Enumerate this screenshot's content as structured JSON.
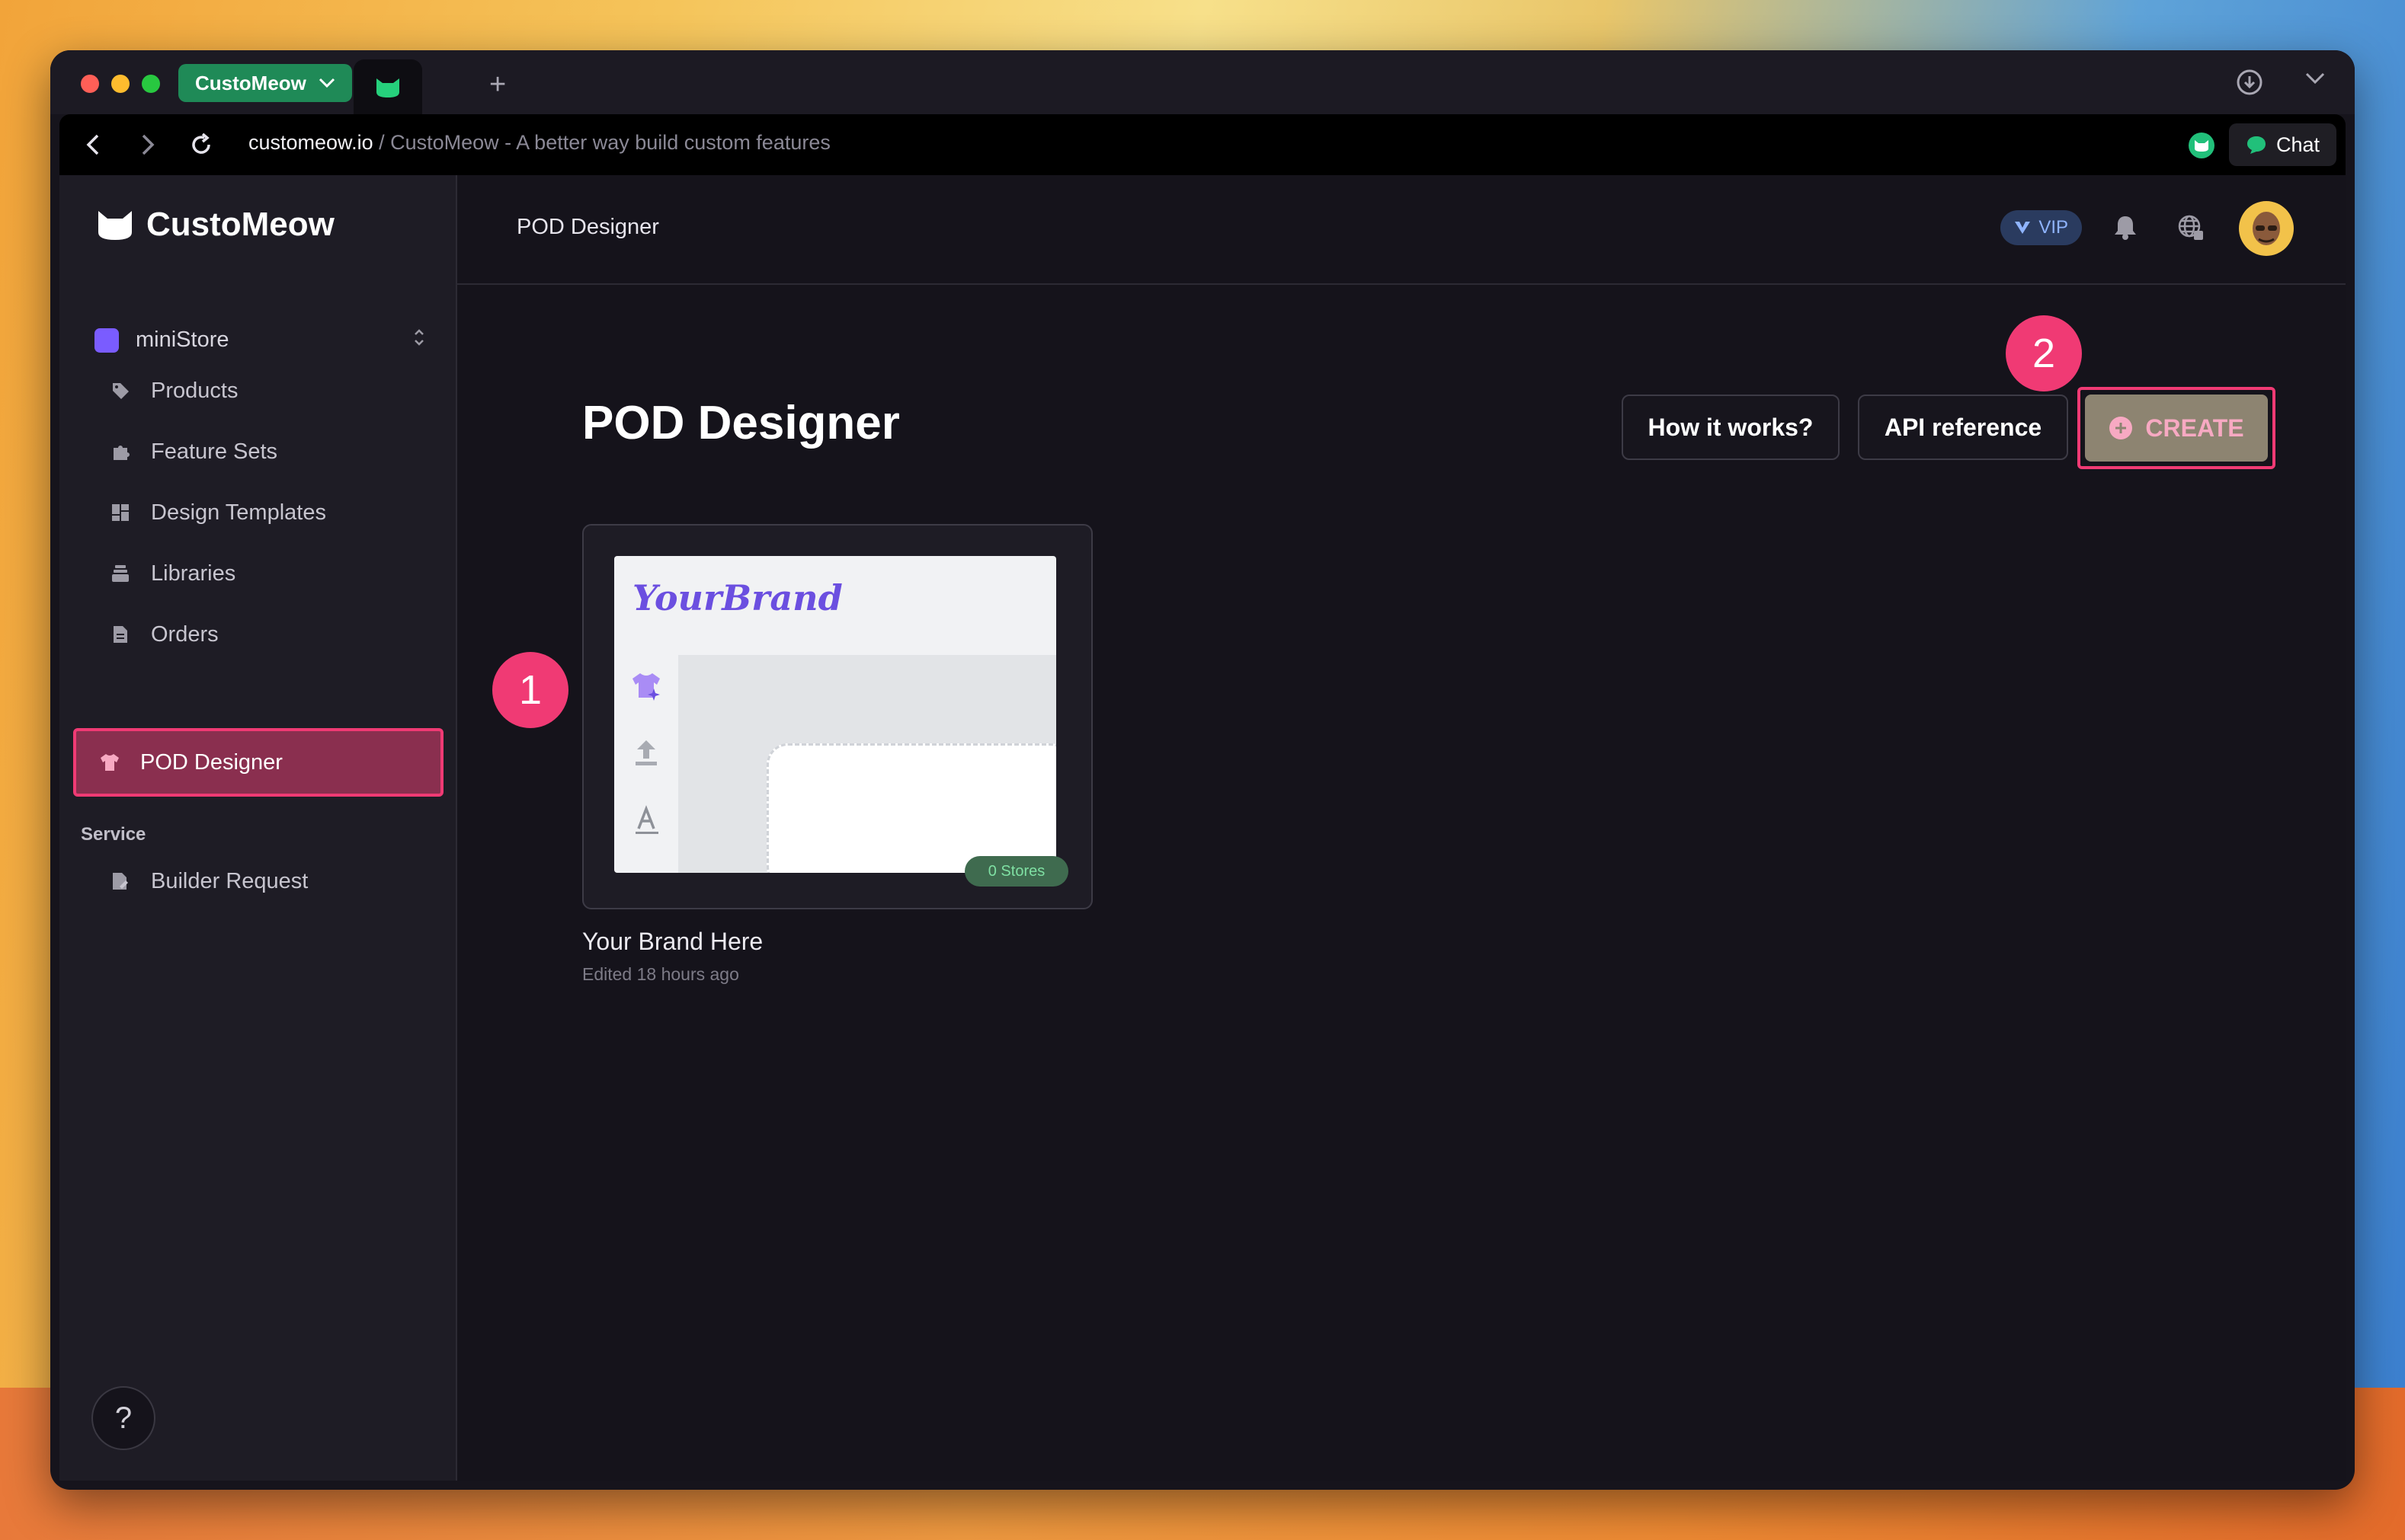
{
  "browser": {
    "tab_group_label": "CustoMeow",
    "url_host": "customeow.io",
    "url_rest": " / CustoMeow - A better way build custom features",
    "chat_label": "Chat"
  },
  "sidebar": {
    "brand": "CustoMeow",
    "store": "miniStore",
    "items": [
      {
        "label": "Products",
        "icon": "tag-icon"
      },
      {
        "label": "Feature Sets",
        "icon": "puzzle-icon"
      },
      {
        "label": "Design Templates",
        "icon": "grid-icon"
      },
      {
        "label": "Libraries",
        "icon": "stack-icon"
      },
      {
        "label": "Orders",
        "icon": "document-icon"
      },
      {
        "label": "POD Designer",
        "icon": "shirt-icon"
      }
    ],
    "section": "Service",
    "service_items": [
      {
        "label": "Builder Request",
        "icon": "document-edit-icon"
      }
    ],
    "help": "?"
  },
  "header": {
    "breadcrumb": "POD Designer",
    "vip": "VIP"
  },
  "main": {
    "title": "POD Designer",
    "how_it_works": "How it works?",
    "api_reference": "API reference",
    "create": "CREATE",
    "card": {
      "thumb_brand": "YourBrand",
      "stores_badge": "0 Stores",
      "title": "Your Brand Here",
      "subtitle": "Edited 18 hours ago"
    }
  },
  "annotations": {
    "step1": "1",
    "step2": "2"
  },
  "colors": {
    "accent": "#f03a74",
    "brand_green": "#1f8a57",
    "active_bg": "#8a2f4f"
  }
}
